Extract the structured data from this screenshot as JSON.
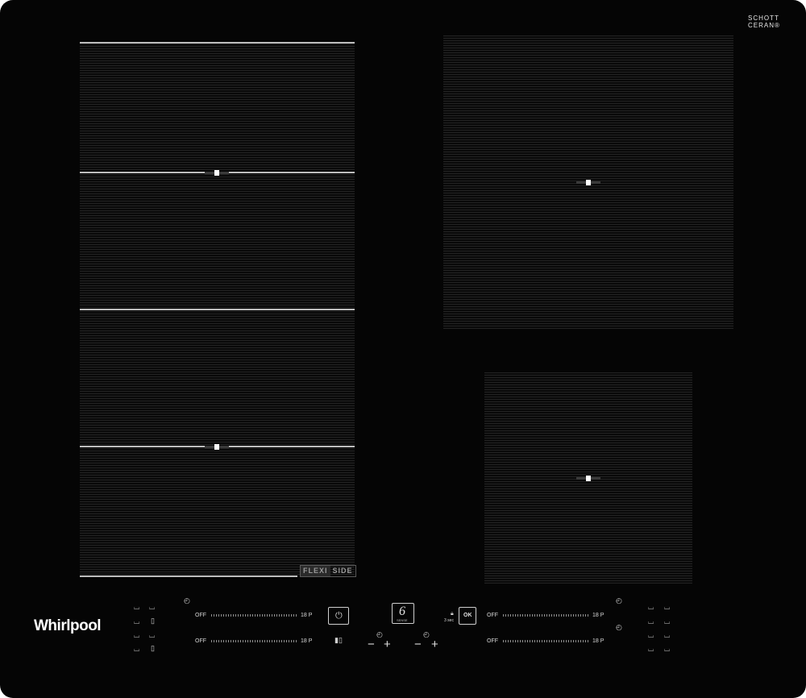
{
  "brand": {
    "schott_line1": "SCHOTT",
    "schott_line2": "CERAN®",
    "logo": "Whirlpool"
  },
  "flexi_label": [
    "FLEXI",
    "SIDE"
  ],
  "controls": {
    "left_top": {
      "off": "OFF",
      "max": "18 P"
    },
    "left_bottom": {
      "off": "OFF",
      "max": "18 P"
    },
    "right_top": {
      "off": "OFF",
      "max": "18 P"
    },
    "right_bottom": {
      "off": "OFF",
      "max": "18 P"
    },
    "sixth_sense": "6",
    "sixth_sense_sub": "SENSE",
    "ok_label": "OK",
    "lock_label": "3 sec",
    "minus": "−",
    "plus": "+"
  },
  "icons": {
    "power": "power-icon",
    "pot": "pot-icon",
    "pan": "pan-icon",
    "timer": "timer-icon",
    "lock": "lock-icon",
    "bridge": "bridge-icon"
  },
  "colors": {
    "glass": "#050505",
    "lines": "#232323",
    "text": "#d9d9d9"
  }
}
